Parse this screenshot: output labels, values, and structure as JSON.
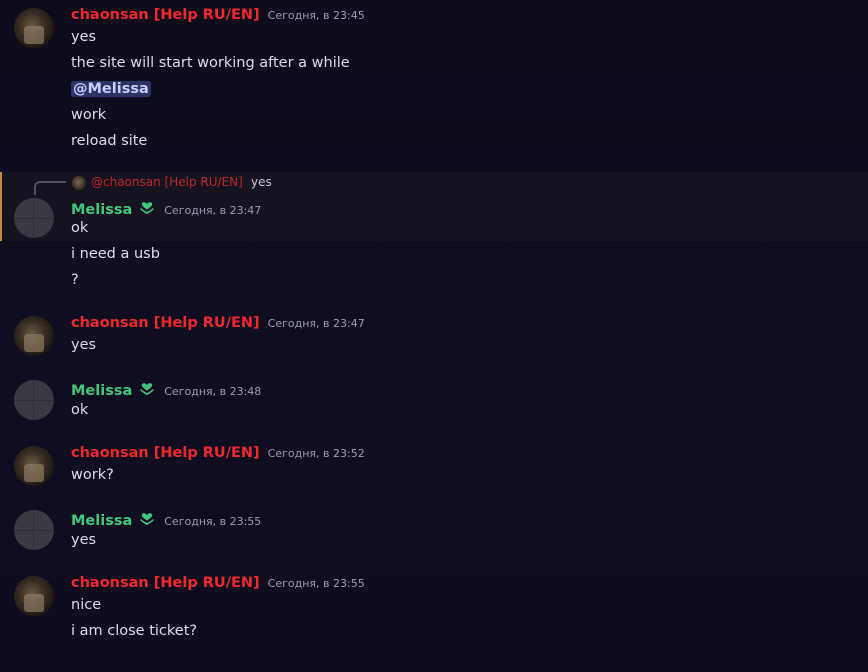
{
  "users": {
    "chaonsan": "chaonsan [Help RU/EN]",
    "melissa": "Melissa"
  },
  "badge_icon": "heart-hands-icon",
  "colors": {
    "chaonsan_name": "#f2262d",
    "melissa_name": "#3fc77b",
    "mention_bg": "#2e3267",
    "highlight_bar": "#c8893a"
  },
  "messages": [
    {
      "author": "chaonsan [Help RU/EN]",
      "time": "Сегодня, в 23:45",
      "lines": [
        "yes",
        "the site will start working after a while",
        "@Melissa",
        "work",
        "reload site"
      ]
    },
    {
      "reply_to_author": "@chaonsan [Help RU/EN]",
      "reply_to_text": "yes",
      "author": "Melissa",
      "time": "Сегодня, в 23:47",
      "lines": [
        "ok",
        "i need a usb",
        "?"
      ]
    },
    {
      "author": "chaonsan [Help RU/EN]",
      "time": "Сегодня, в 23:47",
      "lines": [
        "yes"
      ]
    },
    {
      "author": "Melissa",
      "time": "Сегодня, в 23:48",
      "lines": [
        "ok"
      ]
    },
    {
      "author": "chaonsan [Help RU/EN]",
      "time": "Сегодня, в 23:52",
      "lines": [
        "work?"
      ]
    },
    {
      "author": "Melissa",
      "time": "Сегодня, в 23:55",
      "lines": [
        "yes"
      ]
    },
    {
      "author": "chaonsan [Help RU/EN]",
      "time": "Сегодня, в 23:55",
      "lines": [
        "nice",
        "i am close ticket?"
      ]
    }
  ]
}
